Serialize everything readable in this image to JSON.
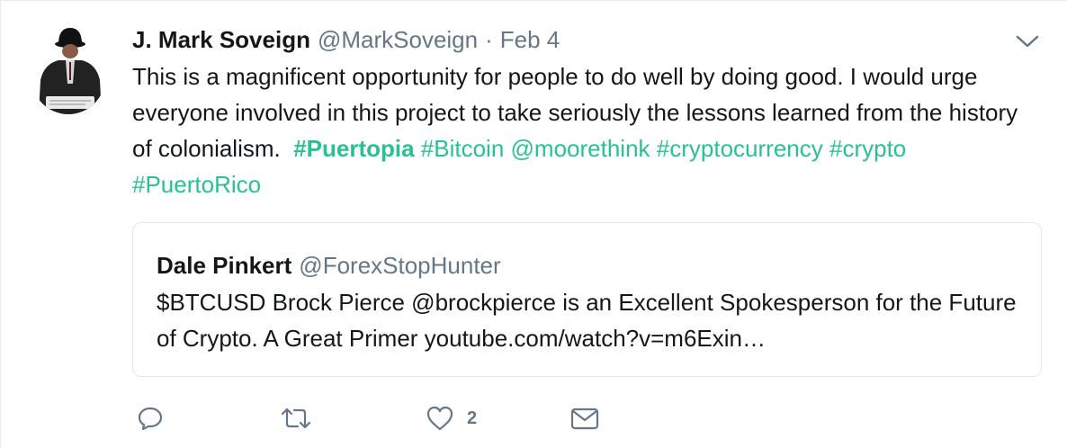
{
  "tweet": {
    "author_name": "J. Mark Soveign",
    "author_handle": "@MarkSoveign",
    "separator": "·",
    "date": "Feb 4",
    "text_plain": "This is a magnificent opportunity for people to do well by doing good. I would urge everyone involved in this project to take seriously the lessons learned from the history of colonialism.",
    "entities": [
      "#Puertopia",
      "#Bitcoin",
      "@moorethink",
      "#cryptocurrency",
      "#crypto",
      "#PuertoRico"
    ],
    "link_color": "#2bc08f"
  },
  "quoted": {
    "author_name": "Dale Pinkert",
    "author_handle": "@ForexStopHunter",
    "text": "$BTCUSD Brock Pierce @brockpierce is an Excellent Spokesperson for the Future of Crypto. A Great Primer youtube.com/watch?v=m6Exin…"
  },
  "actions": {
    "reply_icon": "reply-icon",
    "retweet_icon": "retweet-icon",
    "like_icon": "heart-icon",
    "like_count": "2",
    "dm_icon": "envelope-icon"
  },
  "colors": {
    "secondary_text": "#657786",
    "border": "#e1e8ed"
  }
}
